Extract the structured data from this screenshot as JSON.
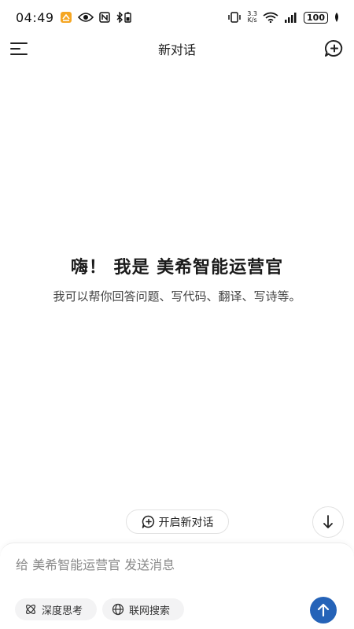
{
  "status_bar": {
    "time": "04:49",
    "speed_value": "3.3",
    "speed_unit": "K/s",
    "battery": "100"
  },
  "header": {
    "title": "新对话"
  },
  "welcome": {
    "title": "嗨！ 我是 美希智能运营官",
    "subtitle": "我可以帮你回答问题、写代码、翻译、写诗等。"
  },
  "actions": {
    "open_new_chat_label": "开启新对话"
  },
  "composer": {
    "placeholder": "给 美希智能运营官 发送消息",
    "value": "",
    "deep_think_label": "深度思考",
    "web_search_label": "联网搜索"
  },
  "colors": {
    "accent": "#2563b8",
    "chip_bg": "#f3f3f4",
    "app_icon": "#f5a623"
  },
  "icons": {
    "menu": "menu-icon",
    "new_chat": "new-chat-icon",
    "scroll_down": "arrow-down-icon",
    "send": "arrow-up-icon",
    "deep_think": "atom-icon",
    "web_search": "globe-icon"
  }
}
